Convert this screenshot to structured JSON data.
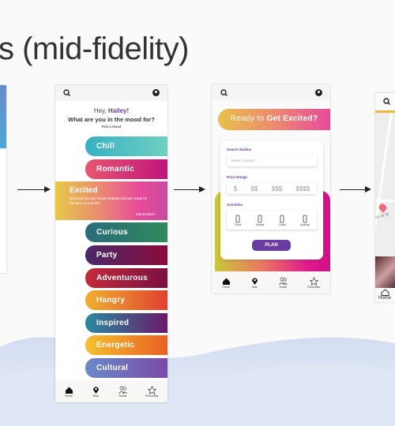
{
  "slide_title": "s (mid-fidelity)",
  "mood_screen": {
    "greeting_prefix": "Hey, ",
    "user_name": "Hailey!",
    "question": "What are you in the mood for?",
    "subtitle": "Pick a Mood",
    "moods": [
      {
        "label": "Chill",
        "gradient": [
          "#37b0c4",
          "#6fd0c0"
        ]
      },
      {
        "label": "Romantic",
        "gradient": [
          "#e8566f",
          "#c0147e"
        ]
      },
      {
        "label": "Curious",
        "gradient": [
          "#2a6c7a",
          "#2e8a5a"
        ]
      },
      {
        "label": "Party",
        "gradient": [
          "#4a2a6a",
          "#8a0a3a"
        ]
      },
      {
        "label": "Adventurous",
        "gradient": [
          "#c62a3a",
          "#7a1040"
        ]
      },
      {
        "label": "Hangry",
        "gradient": [
          "#f0b030",
          "#e04030"
        ]
      },
      {
        "label": "Inspired",
        "gradient": [
          "#2a8aa0",
          "#6a1a6a"
        ]
      },
      {
        "label": "Energetic",
        "gradient": [
          "#f5c030",
          "#e86020"
        ]
      },
      {
        "label": "Cultural",
        "gradient": [
          "#6a8ac8",
          "#7a4aa8"
        ]
      }
    ],
    "excited": {
      "label": "Excited",
      "description": "Discover fun and social settings and get ready for the time of your life.",
      "cta": "Get Excited"
    }
  },
  "plan_screen": {
    "banner_prefix": "Ready to ",
    "banner_bold": "Get Excited?",
    "search_radius_label": "Search Radius",
    "location_placeholder": "Select Location",
    "price_range_label": "Price Range",
    "prices": [
      "$",
      "$$",
      "$$$",
      "$$$$"
    ],
    "activities_label": "Activities",
    "activities": [
      {
        "label": "Food",
        "icon": "fork-knife-icon"
      },
      {
        "label": "Drinks",
        "icon": "cocktail-icon"
      },
      {
        "label": "Clubs",
        "icon": "dancers-icon"
      },
      {
        "label": "Activity",
        "icon": "activity-icon"
      }
    ],
    "plan_button": "PLAN"
  },
  "nav": [
    {
      "label": "Home",
      "icon": "home-icon"
    },
    {
      "label": "Map",
      "icon": "map-pin-icon"
    },
    {
      "label": "Social",
      "icon": "people-icon"
    },
    {
      "label": "Favourites",
      "icon": "star-icon"
    }
  ],
  "map_screen": {
    "street": "en St W",
    "nav_home": "Home"
  },
  "colors": {
    "accent": "#6a3ca0",
    "plan_button": "#6a3ca0"
  }
}
